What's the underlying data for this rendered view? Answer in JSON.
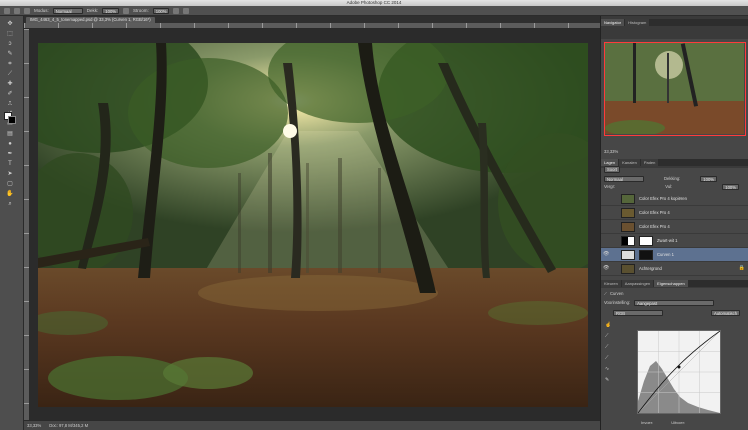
{
  "app": {
    "title": "Adobe Photoshop CC 2014"
  },
  "options_bar": {
    "mode_label": "Modus:",
    "mode_value": "Normaal",
    "opacity_label": "Dekk:",
    "opacity_value": "100%",
    "flow_label": "Stroom:",
    "flow_value": "100%"
  },
  "document": {
    "tab_title": "IMG_4463_4_5_tonemapped.psd @ 33,3% (Curven 1, RGB/16*)"
  },
  "status": {
    "zoom": "33,33%",
    "doc_size": "Doc: 97,8 M/345,2 M"
  },
  "navigator": {
    "tabs": [
      {
        "label": "Navigator",
        "active": true
      },
      {
        "label": "Histogram",
        "active": false
      }
    ],
    "zoom": "33,33%"
  },
  "layers_panel": {
    "tabs": [
      {
        "label": "Lagen",
        "active": true
      },
      {
        "label": "Kanalen",
        "active": false
      },
      {
        "label": "Paden",
        "active": false
      }
    ],
    "filter": "Soort",
    "blend_mode": "Normaal",
    "opacity_label": "Dekking:",
    "opacity_value": "100%",
    "fill_label": "Vul:",
    "fill_value": "100%",
    "lock_label": "Vergr:",
    "layers": [
      {
        "name": "Color Efex Pro 4 kopiëren",
        "visible": false,
        "selected": false,
        "type": "image"
      },
      {
        "name": "Color Efex Pro 4",
        "visible": false,
        "selected": false,
        "type": "image"
      },
      {
        "name": "Color Efex Pro 4",
        "visible": false,
        "selected": false,
        "type": "image"
      },
      {
        "name": "Zwart-wit 1",
        "visible": false,
        "selected": false,
        "type": "adjustment"
      },
      {
        "name": "Curven 1",
        "visible": true,
        "selected": true,
        "type": "curves"
      },
      {
        "name": "Achtergrond",
        "visible": true,
        "selected": false,
        "type": "image"
      }
    ]
  },
  "properties_panel": {
    "tabs": [
      {
        "label": "Kleuren",
        "active": false
      },
      {
        "label": "Aanpassingen",
        "active": false
      },
      {
        "label": "Eigenschappen",
        "active": true
      }
    ],
    "title": "Curven",
    "preset_label": "Voorinstelling:",
    "preset_value": "Aangepast",
    "channel_value": "RGB",
    "auto_label": "Automatisch",
    "input_label": "Invoer:",
    "output_label": "Uitvoer:"
  },
  "colors": {
    "selection": "#5d7190",
    "nav_highlight": "#ff3b3b"
  }
}
